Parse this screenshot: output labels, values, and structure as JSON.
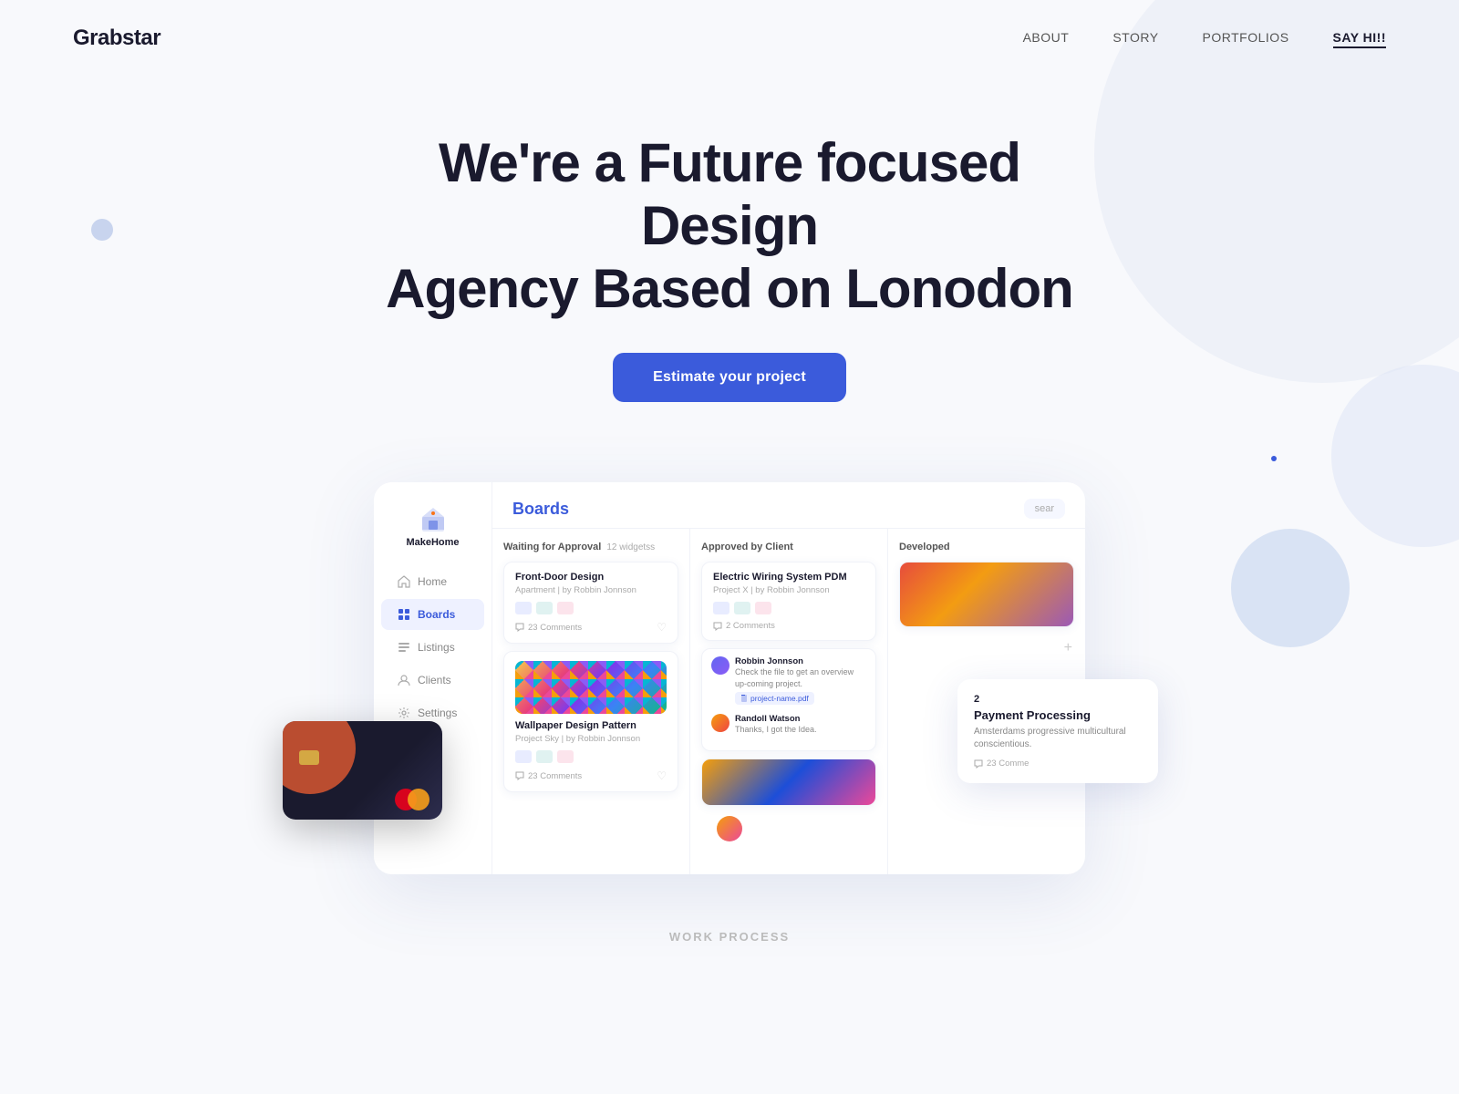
{
  "nav": {
    "logo": "Grabstar",
    "links": [
      {
        "label": "ABOUT",
        "active": false
      },
      {
        "label": "STORY",
        "active": false
      },
      {
        "label": "PORTFOLIOS",
        "active": false
      },
      {
        "label": "SAY HI!!",
        "active": true
      }
    ]
  },
  "hero": {
    "title_line1": "We're a Future focused Design",
    "title_line2": "Agency Based on Lonodon",
    "cta_button": "Estimate your project"
  },
  "app": {
    "sidebar": {
      "logo_text": "MakeHome",
      "nav_items": [
        {
          "label": "Home",
          "active": false
        },
        {
          "label": "Boards",
          "active": true
        },
        {
          "label": "Listings",
          "active": false
        },
        {
          "label": "Clients",
          "active": false
        },
        {
          "label": "Settings",
          "active": false
        }
      ]
    },
    "main": {
      "title": "Boards",
      "search_placeholder": "sear",
      "columns": [
        {
          "name": "Waiting for Approval",
          "count": "12 widgetss",
          "cards": [
            {
              "title": "Front-Door Design",
              "meta": "Apartment  |  by Robbin Jonnson",
              "comments": "23 Comments"
            },
            {
              "title": "Wallpaper Design Pattern",
              "meta": "Project Sky  |  by Robbin Jonnson",
              "comments": "23 Comments"
            }
          ]
        },
        {
          "name": "Approved by Client",
          "cards": [
            {
              "title": "Electric Wiring System PDM",
              "meta": "Project X  |  by Robbin Jonnson",
              "comments": "2 Comments"
            }
          ],
          "chat": {
            "users": [
              {
                "name": "Robbin Jonnson",
                "text": "Check the file to get an overview up-coming project.",
                "file": "project-name.pdf"
              },
              {
                "name": "Randoll Watson",
                "text": "Thanks, I got the Idea."
              }
            ]
          }
        },
        {
          "name": "Developed",
          "popup": {
            "number": "2",
            "title": "Payment Processing",
            "description": "Amsterdams progressive multicultural conscientious.",
            "comments": "23 Comme"
          }
        }
      ]
    }
  },
  "work_process": {
    "label": "WORK PROCESS"
  }
}
